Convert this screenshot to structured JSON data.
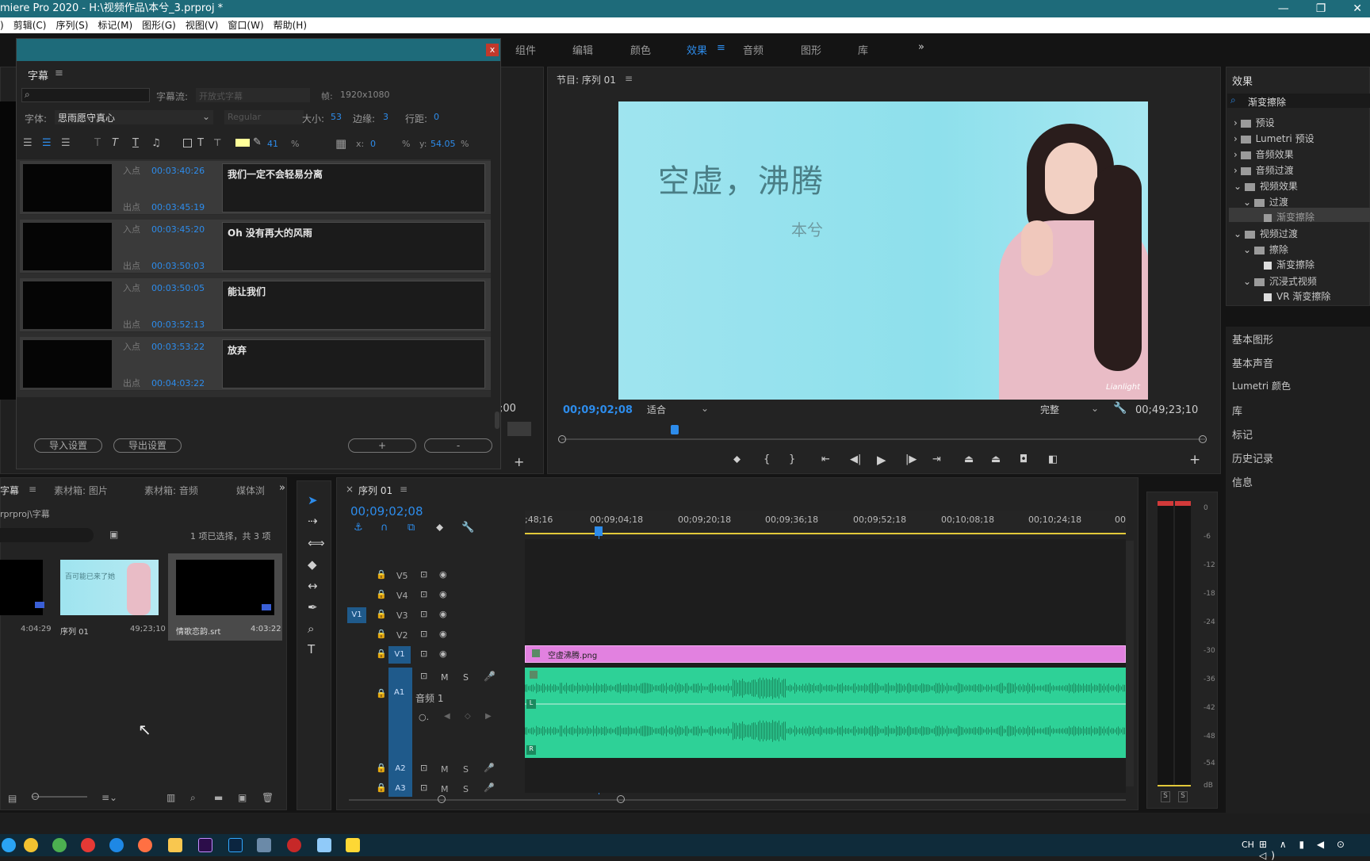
{
  "window": {
    "title": "miere Pro 2020 - H:\\视频作品\\本兮_3.prproj *",
    "controls": [
      "—",
      "❐",
      "✕"
    ]
  },
  "menu": [
    "剪辑(C)",
    "序列(S)",
    "标记(M)",
    "图形(G)",
    "视图(V)",
    "窗口(W)",
    "帮助(H)"
  ],
  "menu_prefix": ")",
  "workspace_tabs": [
    "组件",
    "编辑",
    "颜色",
    "效果",
    "音频",
    "图形",
    "库"
  ],
  "workspace_active": "效果",
  "workspace_more": "»",
  "caption_panel": {
    "title": "字幕",
    "search_placeholder": "",
    "stream_label": "字幕流:",
    "stream_value": "开放式字幕",
    "frame_label": "帧:",
    "frame_value": "1920x1080",
    "font_label": "字体:",
    "font_value": "思雨愿守真心",
    "style_value": "Regular",
    "size_label": "大小:",
    "size_value": "53",
    "edge_label": "边缘:",
    "edge_value": "3",
    "line_label": "行距:",
    "line_value": "0",
    "opacity_value": "41",
    "pct": "%",
    "x_label": "x:",
    "x_value": "0",
    "y_label": "y:",
    "y_value": "54.05",
    "in_label": "入点",
    "out_label": "出点",
    "rows": [
      {
        "in": "00:03:40:26",
        "out": "00:03:45:19",
        "text": "我们一定不会轻易分离"
      },
      {
        "in": "00:03:45:20",
        "out": "00:03:50:03",
        "text": "Oh 没有再大的风雨"
      },
      {
        "in": "00:03:50:05",
        "out": "00:03:52:13",
        "text": "能让我们"
      },
      {
        "in": "00:03:53:22",
        "out": "00:04:03:22",
        "text": "放弃"
      }
    ],
    "import_btn": "导入设置",
    "export_btn": "导出设置",
    "add_btn": "+",
    "remove_btn": "-"
  },
  "program_monitor": {
    "title": "节目: 序列 01",
    "current_time": "00;09;02;08",
    "zoom": "适合",
    "quality": "完整",
    "duration": "00;49;23;10",
    "frame_text": "空虚，沸腾",
    "frame_subtext": "本兮",
    "watermark": "Lianlight",
    "left_time": ";00"
  },
  "effects_panel": {
    "title": "效果",
    "search_value": "渐变擦除",
    "tree": [
      {
        "label": "预设",
        "level": 0
      },
      {
        "label": "Lumetri 预设",
        "level": 0
      },
      {
        "label": "音频效果",
        "level": 0
      },
      {
        "label": "音频过渡",
        "level": 0
      },
      {
        "label": "视频效果",
        "level": 0
      },
      {
        "label": "过渡",
        "level": 1
      },
      {
        "label": "渐变擦除",
        "level": 2
      },
      {
        "label": "视频过渡",
        "level": 0
      },
      {
        "label": "擦除",
        "level": 1
      },
      {
        "label": "渐变擦除",
        "level": 2
      },
      {
        "label": "沉浸式视频",
        "level": 1
      },
      {
        "label": "VR 渐变擦除",
        "level": 2
      }
    ],
    "sections": [
      "基本图形",
      "基本声音",
      "Lumetri 颜色",
      "库",
      "标记",
      "历史记录",
      "信息"
    ]
  },
  "project_panel": {
    "tabs": [
      "字幕",
      "素材箱: 图片",
      "素材箱: 音频",
      "媒体浏"
    ],
    "more": "»",
    "path": "rprproj\\字幕",
    "selection_info": "1 项已选择，共 3 项",
    "items": [
      {
        "name": "",
        "duration": "4:04:29"
      },
      {
        "name": "序列 01",
        "duration": "49;23;10"
      },
      {
        "name": "情歌恋韵.srt",
        "duration": "4:03:22"
      }
    ],
    "thumb_text": "百可能已来了她"
  },
  "timeline": {
    "tab": "序列 01",
    "current_time": "00;09;02;08",
    "ruler": [
      ";48;16",
      "00;09;04;18",
      "00;09;20;18",
      "00;09;36;18",
      "00;09;52;18",
      "00;10;08;18",
      "00;10;24;18",
      "00"
    ],
    "video_tracks": [
      "V5",
      "V4",
      "V3",
      "V2",
      "V1"
    ],
    "source_patch": "V1",
    "audio_tracks": [
      "A1",
      "A2",
      "A3"
    ],
    "audio_track_name": "音频 1",
    "clip_name": "空虚沸腾.png",
    "m_label": "M",
    "s_label": "S"
  },
  "meter": {
    "ticks": [
      "0",
      "-6",
      "-12",
      "-18",
      "-24",
      "-30",
      "-36",
      "-42",
      "-48",
      "-54",
      "dB"
    ],
    "solo": [
      "S",
      "S"
    ]
  },
  "taskbar": {
    "lang": "CH",
    "tray": "⊞ ∧ ▮ ◀ ⊙ ◁)"
  },
  "colors": {
    "accent": "#2d8ceb",
    "clip_video": "#e281e0",
    "clip_audio": "#2ed197",
    "titlebar": "#1e6b7a"
  }
}
